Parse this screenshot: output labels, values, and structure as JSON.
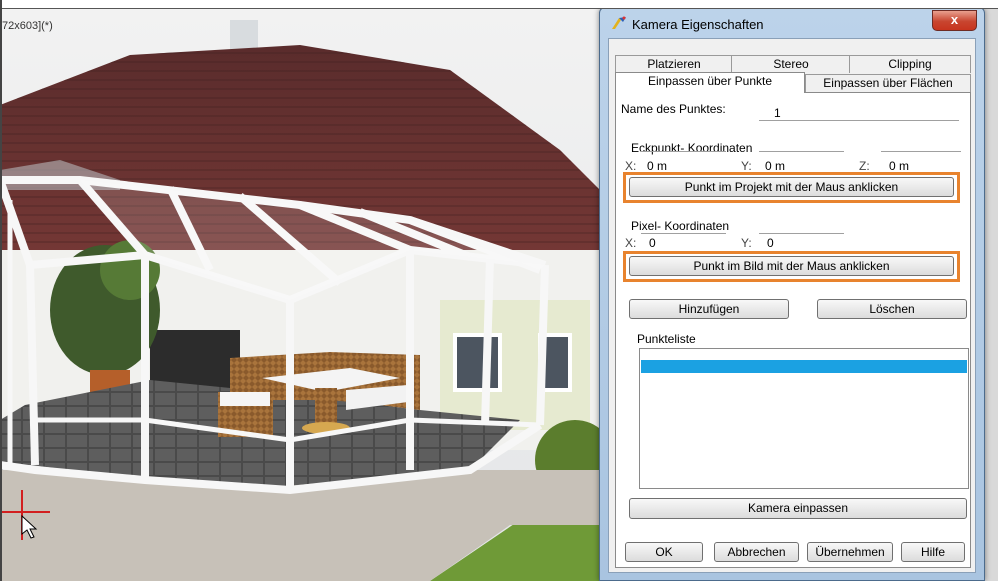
{
  "viewport": {
    "title": "72x603](*)"
  },
  "dialog": {
    "title": "Kamera Eigenschaften",
    "close_label": "x",
    "tabs_row1": [
      {
        "label": "Platzieren"
      },
      {
        "label": "Stereo"
      },
      {
        "label": "Clipping"
      }
    ],
    "tabs_row2": [
      {
        "label": "Einpassen über Punkte",
        "active": true
      },
      {
        "label": "Einpassen über Flächen"
      }
    ],
    "point_name": {
      "label": "Name des Punktes:",
      "value": "1"
    },
    "corner": {
      "heading": "Eckpunkt- Koordinaten",
      "x_label": "X:",
      "x_value": "0 m",
      "y_label": "Y:",
      "y_value": "0 m",
      "z_label": "Z:",
      "z_value": "0 m",
      "button": "Punkt im Projekt mit der Maus anklicken"
    },
    "pixel": {
      "heading": "Pixel- Koordinaten",
      "x_label": "X:",
      "x_value": "0",
      "y_label": "Y:",
      "y_value": "0",
      "button": "Punkt im Bild mit der Maus anklicken"
    },
    "add_button": "Hinzufügen",
    "delete_button": "Löschen",
    "list_label": "Punkteliste",
    "fit_button": "Kamera einpassen",
    "footer": {
      "ok": "OK",
      "cancel": "Abbrechen",
      "apply": "Übernehmen",
      "help": "Hilfe"
    },
    "highlight_color": "#e8832e",
    "selection_color": "#1ba1e2"
  }
}
